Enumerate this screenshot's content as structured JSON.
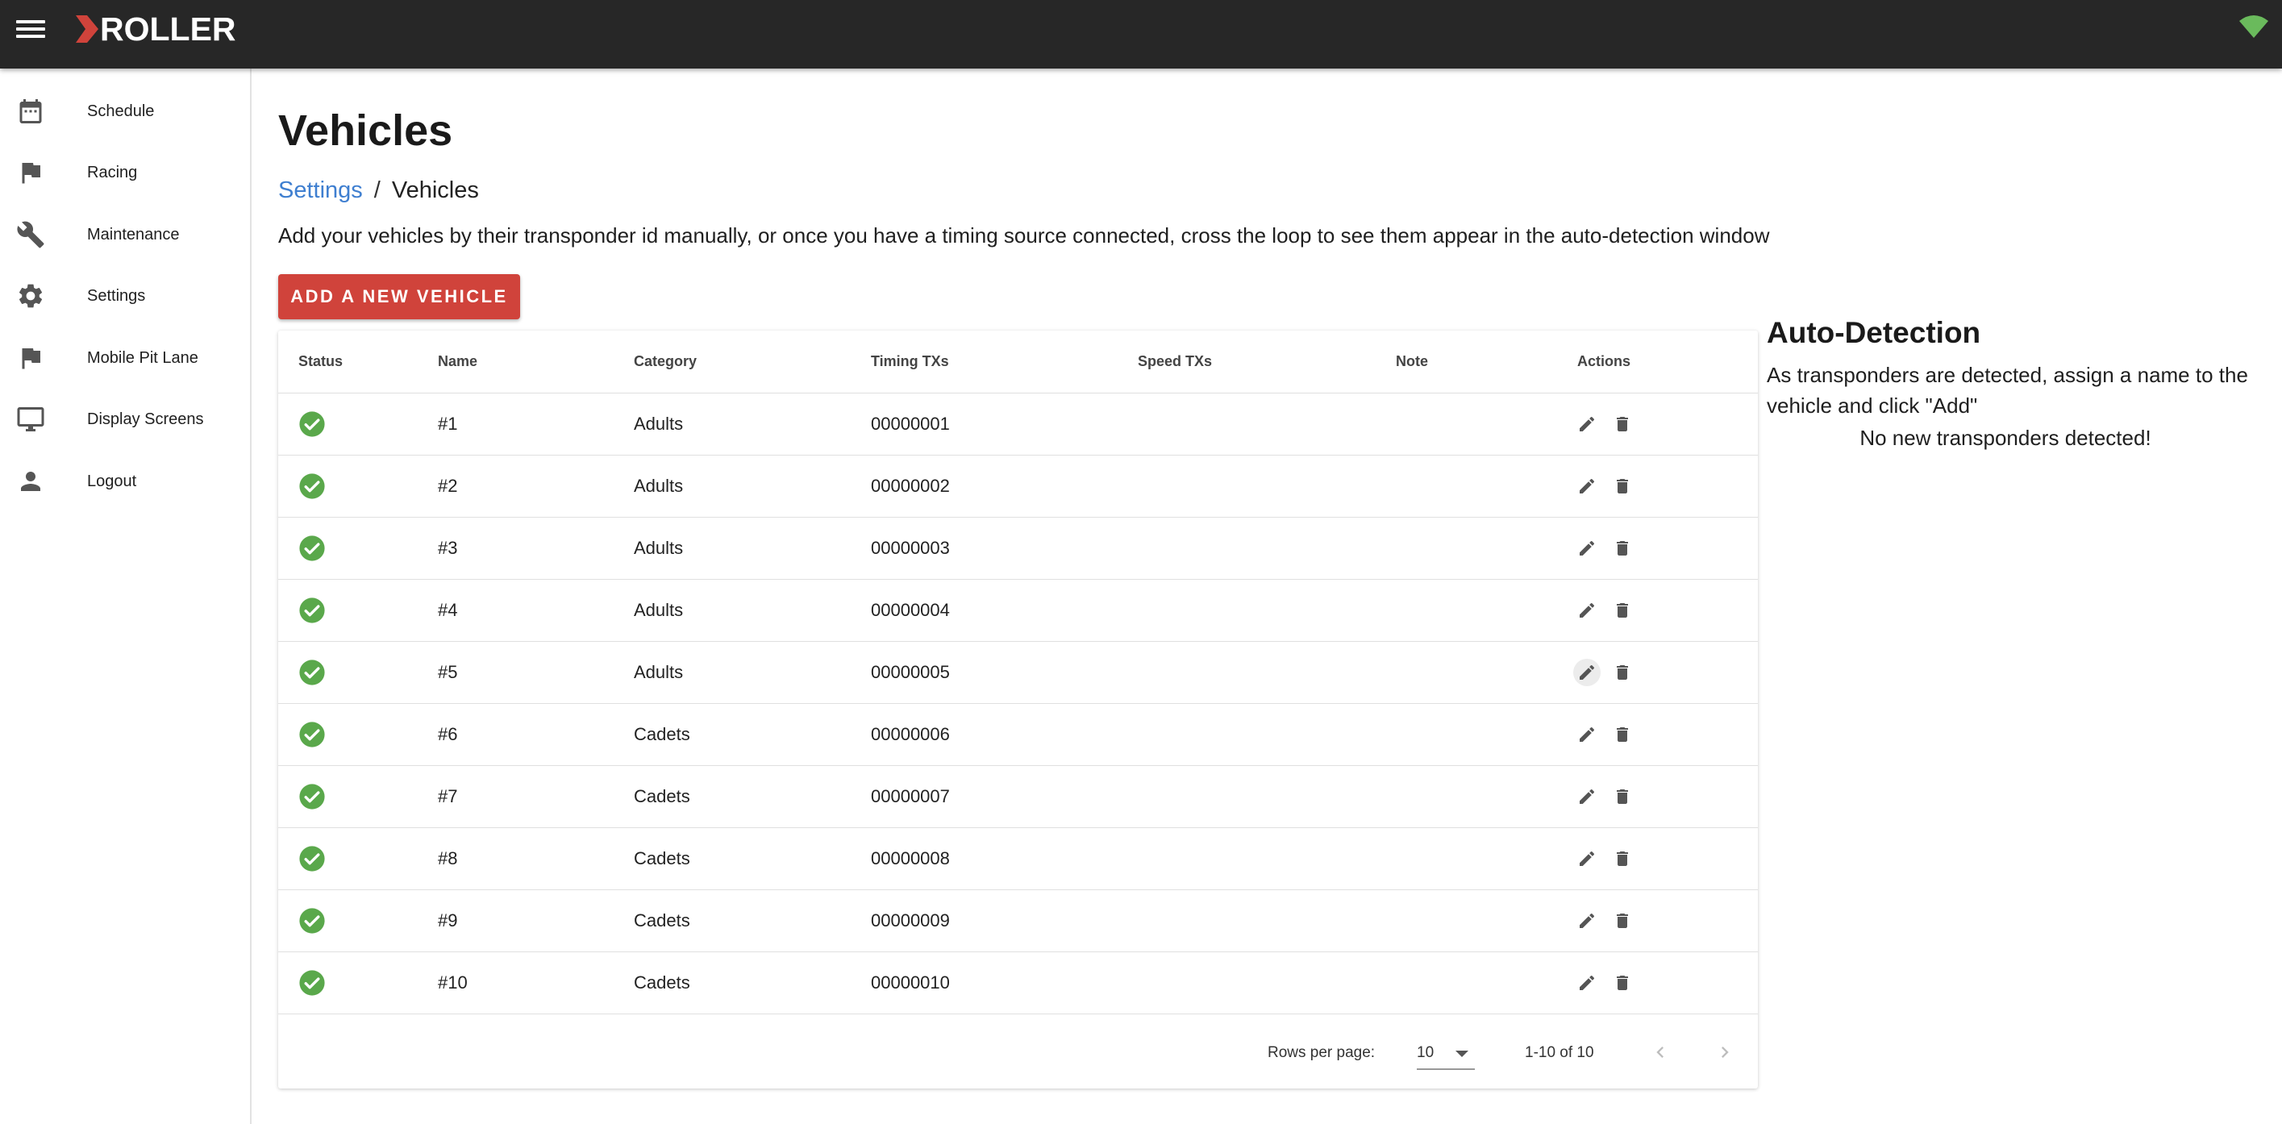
{
  "app": {
    "logo_text": "ROLLER",
    "logo_color": "#d0433b",
    "topbar_color": "#272727",
    "status_color": "#2e8b3a"
  },
  "sidebar": {
    "items": [
      {
        "label": "Schedule",
        "icon": "calendar-icon"
      },
      {
        "label": "Racing",
        "icon": "flag-icon"
      },
      {
        "label": "Maintenance",
        "icon": "wrench-icon"
      },
      {
        "label": "Settings",
        "icon": "gear-icon"
      },
      {
        "label": "Mobile Pit Lane",
        "icon": "flag-icon"
      },
      {
        "label": "Display Screens",
        "icon": "monitor-icon"
      },
      {
        "label": "Logout",
        "icon": "person-icon"
      }
    ]
  },
  "main": {
    "title": "Vehicles",
    "breadcrumb": {
      "parent": "Settings",
      "separator": "/",
      "current": "Vehicles"
    },
    "intro": "Add your vehicles by their transponder id manually, or once you have a timing source connected, cross the loop to see them appear in the auto-detection window",
    "add_button": "ADD A NEW VEHICLE"
  },
  "table": {
    "headers": {
      "status": "Status",
      "name": "Name",
      "category": "Category",
      "timing": "Timing TXs",
      "speed": "Speed TXs",
      "note": "Note",
      "actions": "Actions"
    },
    "rows": [
      {
        "name": "#1",
        "category": "Adults",
        "timing": "00000001",
        "speed": "",
        "note": ""
      },
      {
        "name": "#2",
        "category": "Adults",
        "timing": "00000002",
        "speed": "",
        "note": ""
      },
      {
        "name": "#3",
        "category": "Adults",
        "timing": "00000003",
        "speed": "",
        "note": ""
      },
      {
        "name": "#4",
        "category": "Adults",
        "timing": "00000004",
        "speed": "",
        "note": ""
      },
      {
        "name": "#5",
        "category": "Adults",
        "timing": "00000005",
        "speed": "",
        "note": ""
      },
      {
        "name": "#6",
        "category": "Cadets",
        "timing": "00000006",
        "speed": "",
        "note": ""
      },
      {
        "name": "#7",
        "category": "Cadets",
        "timing": "00000007",
        "speed": "",
        "note": ""
      },
      {
        "name": "#8",
        "category": "Cadets",
        "timing": "00000008",
        "speed": "",
        "note": ""
      },
      {
        "name": "#9",
        "category": "Cadets",
        "timing": "00000009",
        "speed": "",
        "note": ""
      },
      {
        "name": "#10",
        "category": "Cadets",
        "timing": "00000010",
        "speed": "",
        "note": ""
      }
    ],
    "pagination": {
      "rows_per_page_label": "Rows per page:",
      "rows_per_page": "10",
      "range": "1-10 of 10"
    }
  },
  "auto_detection": {
    "title": "Auto-Detection",
    "description": "As transponders are detected, assign a name to the vehicle and click \"Add\"",
    "empty": "No new transponders detected!"
  }
}
